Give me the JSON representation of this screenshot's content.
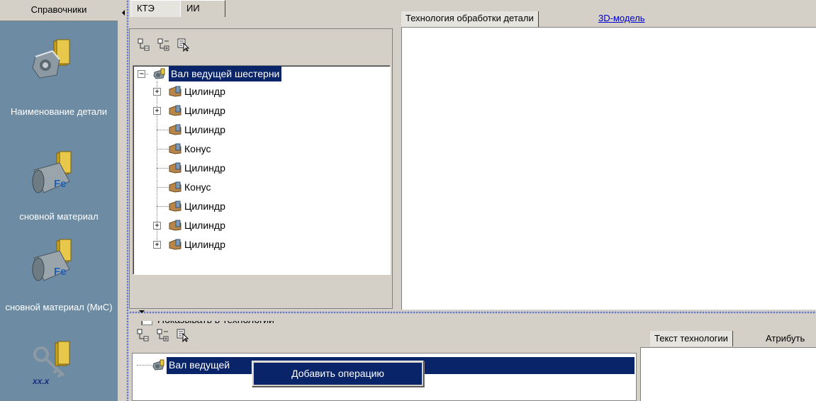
{
  "sidebar": {
    "header": "Справочники",
    "items": [
      {
        "label": "Наименование детали",
        "icon": "gear-part-book-icon"
      },
      {
        "label": "сновной материал",
        "icon": "fe-material-book-icon"
      },
      {
        "label": "сновной материал (МиС)",
        "icon": "fe-material-book-icon"
      },
      {
        "label": "",
        "icon": "key-tolerance-book-icon"
      }
    ]
  },
  "kte_panel": {
    "tabs": [
      "КТЭ",
      "ИИ"
    ],
    "active_tab": "КТЭ",
    "toolbar": [
      "collapse-tree-icon",
      "expand-tree-icon",
      "select-cursor-icon"
    ],
    "tree": {
      "root": "Вал ведущей шестерни",
      "children": [
        {
          "label": "Цилиндр",
          "expandable": true
        },
        {
          "label": "Цилиндр",
          "expandable": true
        },
        {
          "label": "Цилиндр",
          "expandable": false
        },
        {
          "label": "Конус",
          "expandable": false
        },
        {
          "label": "Цилиндр",
          "expandable": false
        },
        {
          "label": "Конус",
          "expandable": false
        },
        {
          "label": "Цилиндр",
          "expandable": false
        },
        {
          "label": "Цилиндр",
          "expandable": true
        },
        {
          "label": "Цилиндр",
          "expandable": true
        }
      ]
    },
    "checkbox_label": "Показывать в технологии",
    "checkbox_checked": false
  },
  "tech_panel": {
    "tabs": [
      "Технология обработки детали",
      "3D-модель"
    ]
  },
  "ops_panel": {
    "toolbar": [
      "collapse-tree-icon",
      "expand-tree-icon",
      "select-cursor-icon"
    ],
    "tree_root": "Вал ведущей",
    "context_menu_item": "Добавить операцию"
  },
  "text_panel": {
    "tabs": [
      "Текст технологии",
      "Атрибуть"
    ]
  },
  "colors": {
    "sidebar_bg": "#6d8ba3",
    "selection": "#0a246a",
    "link": "#0000cc",
    "window_bg": "#d4d0c8"
  }
}
